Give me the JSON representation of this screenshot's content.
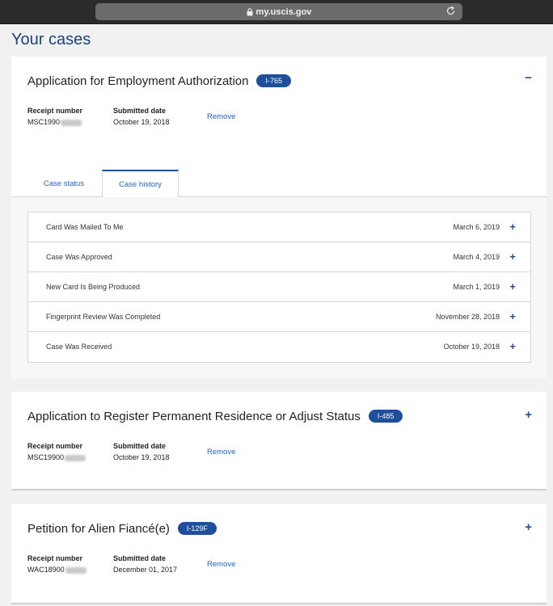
{
  "browser": {
    "url": "my.uscis.gov"
  },
  "page": {
    "title": "Your cases"
  },
  "labels": {
    "receipt_number": "Receipt number",
    "submitted_date": "Submitted date",
    "remove": "Remove"
  },
  "cases": [
    {
      "title": "Application for Employment Authorization",
      "form": "I-765",
      "toggle": "−",
      "receipt_number": "MSC1990",
      "submitted_date": "October 19, 2018",
      "tabs": [
        "Case status",
        "Case history"
      ],
      "history": [
        {
          "title": "Card Was Mailed To Me",
          "date": "March 6, 2019"
        },
        {
          "title": "Case Was Approved",
          "date": "March 4, 2019"
        },
        {
          "title": "New Card Is Being Produced",
          "date": "March 1, 2019"
        },
        {
          "title": "Fingerprint Review Was Completed",
          "date": "November 28, 2018"
        },
        {
          "title": "Case Was Received",
          "date": "October 19, 2018"
        }
      ]
    },
    {
      "title": "Application to Register Permanent Residence or Adjust Status",
      "form": "I-485",
      "toggle": "+",
      "receipt_number": "MSC19900",
      "submitted_date": "October 19, 2018"
    },
    {
      "title": "Petition for Alien Fiancé(e)",
      "form": "I-129F",
      "toggle": "+",
      "receipt_number": "WAC18900",
      "submitted_date": "December 01, 2017"
    }
  ],
  "icons": {
    "lock": "lock-icon",
    "reload": "reload-icon",
    "expand": "plus-icon",
    "collapse": "minus-icon"
  },
  "colors": {
    "accent": "#1f4e9a",
    "link": "#1f63c6",
    "title": "#1a4480"
  }
}
